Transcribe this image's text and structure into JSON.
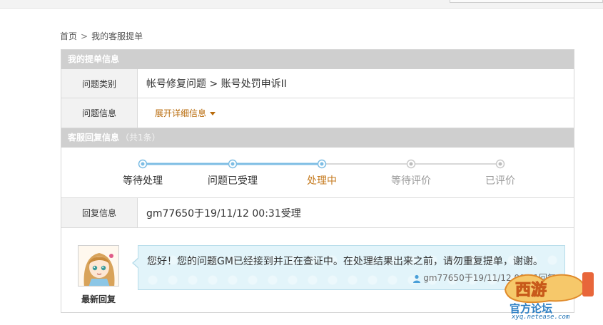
{
  "breadcrumb": {
    "home": "首页",
    "separator": ">",
    "current": "我的客服提单"
  },
  "ticket_section": {
    "title": "我的提单信息"
  },
  "category_row": {
    "label": "问题类别",
    "value": "帐号修复问题 > 账号处罚申诉II"
  },
  "info_row": {
    "label": "问题信息",
    "expand_label": "展开详细信息"
  },
  "reply_section": {
    "title": "客服回复信息",
    "count": "（共1条）"
  },
  "progress": {
    "steps": [
      {
        "label": "等待处理",
        "state": "done"
      },
      {
        "label": "问题已受理",
        "state": "done"
      },
      {
        "label": "处理中",
        "state": "current"
      },
      {
        "label": "等待评价",
        "state": "pending"
      },
      {
        "label": "已评价",
        "state": "pending"
      }
    ],
    "colors": {
      "done": "#7dbde4",
      "current_text": "#c57a1e",
      "pending": "#d8d8d8"
    }
  },
  "reply_row": {
    "label": "回复信息",
    "value": "gm77650于19/11/12 00:31受理"
  },
  "latest_reply": {
    "caption": "最新回复",
    "message": "您好！您的问题GM已经接到并正在查证中。在处理结果出来之前，请勿重复提单，谢谢。",
    "meta": "gm77650于19/11/12 00:31回复",
    "avatar_icon": "girl-avatar-icon",
    "user_icon": "user-icon"
  },
  "watermark": {
    "logo_text": "西游",
    "subtitle": "官方论坛",
    "url": "xyq.netease.com"
  }
}
